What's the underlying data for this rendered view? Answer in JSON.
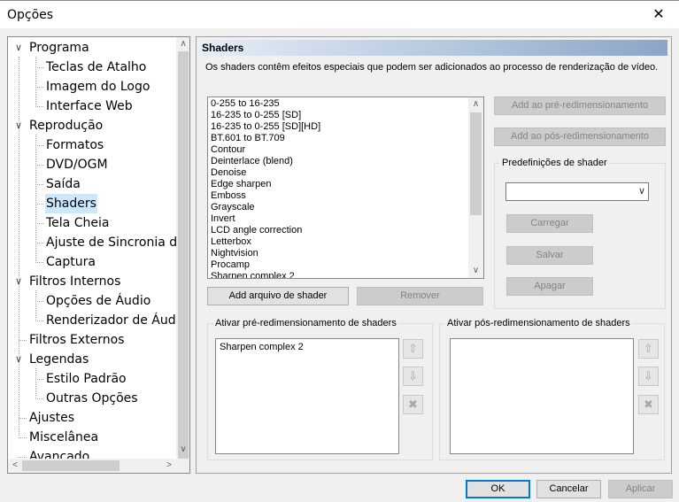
{
  "window": {
    "title": "Opções",
    "close_glyph": "✕"
  },
  "tree": {
    "nodes": [
      {
        "label": "Programa",
        "expander": "∨"
      },
      {
        "label": "Teclas de Atalho"
      },
      {
        "label": "Imagem do Logo"
      },
      {
        "label": "Interface Web"
      },
      {
        "label": "Reprodução",
        "expander": "∨"
      },
      {
        "label": "Formatos"
      },
      {
        "label": "DVD/OGM"
      },
      {
        "label": "Saída"
      },
      {
        "label": "Shaders",
        "selected": true
      },
      {
        "label": "Tela Cheia"
      },
      {
        "label": "Ajuste de Sincronia do"
      },
      {
        "label": "Captura"
      },
      {
        "label": "Filtros Internos",
        "expander": "∨"
      },
      {
        "label": "Opções de Áudio"
      },
      {
        "label": "Renderizador de Áudio"
      },
      {
        "label": "Filtros Externos"
      },
      {
        "label": "Legendas",
        "expander": "∨"
      },
      {
        "label": "Estilo Padrão"
      },
      {
        "label": "Outras Opções"
      },
      {
        "label": "Ajustes"
      },
      {
        "label": "Miscelânea"
      },
      {
        "label": "Avançado"
      }
    ],
    "scroll_up": "∧",
    "scroll_down": "∨",
    "scroll_left": "<",
    "scroll_right": ">"
  },
  "page": {
    "header": "Shaders",
    "description": "Os shaders contêm efeitos especiais que podem ser adicionados ao processo de renderização de vídeo.",
    "shader_list": [
      "0-255 to 16-235",
      "16-235 to 0-255 [SD]",
      "16-235 to 0-255 [SD][HD]",
      "BT.601 to BT.709",
      "Contour",
      "Deinterlace (blend)",
      "Denoise",
      "Edge sharpen",
      "Emboss",
      "Grayscale",
      "Invert",
      "LCD angle correction",
      "Letterbox",
      "Nightvision",
      "Procamp",
      "Sharpen complex 2"
    ],
    "buttons": {
      "add_pre": "Add ao pré-redimensionamento",
      "add_post": "Add ao pós-redimensionamento",
      "add_file": "Add arquivo de shader",
      "remove": "Remover"
    },
    "presets": {
      "label": "Predefinições de shader",
      "selected": "",
      "load": "Carregar",
      "save": "Salvar",
      "delete": "Apagar"
    },
    "pre_resize": {
      "label": "Ativar pré-redimensionamento de shaders",
      "items": [
        "Sharpen complex 2"
      ]
    },
    "post_resize": {
      "label": "Ativar pós-redimensionamento de shaders",
      "items": []
    }
  },
  "footer": {
    "ok": "OK",
    "cancel": "Cancelar",
    "apply": "Aplicar"
  }
}
